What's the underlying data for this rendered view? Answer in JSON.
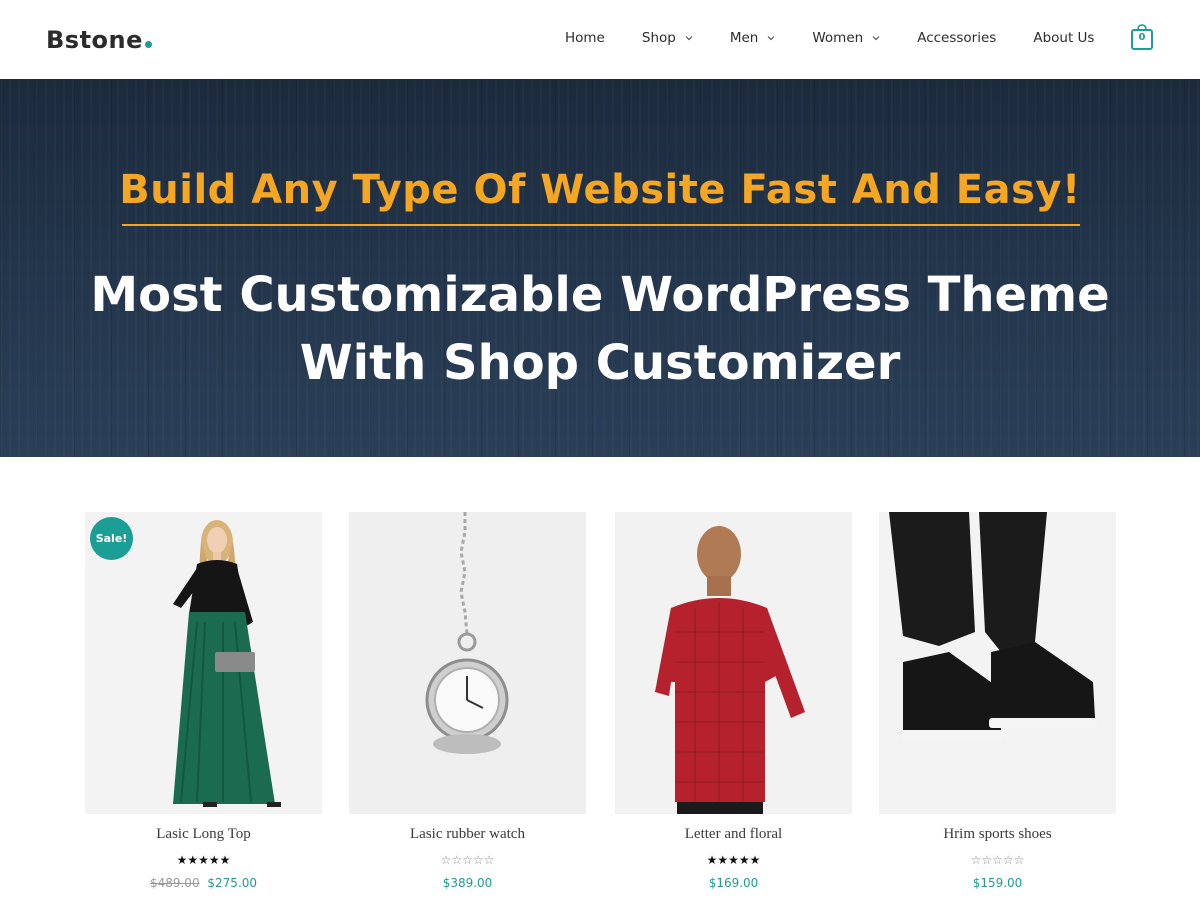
{
  "colors": {
    "accent": "#1a9e95",
    "tagline": "#f5a623",
    "hero_bg": "#22344a",
    "text": "#3a3a3a"
  },
  "header": {
    "logo_text": "Bstone",
    "nav": {
      "home": "Home",
      "shop": "Shop",
      "men": "Men",
      "women": "Women",
      "accessories": "Accessories",
      "about": "About Us"
    },
    "cart_count": "0",
    "cart_icon": "shopping-bag-icon"
  },
  "hero": {
    "tagline": "Build Any Type Of Website Fast And Easy!",
    "title_line1": "Most Customizable WordPress Theme",
    "title_line2": "With Shop Customizer"
  },
  "products": [
    {
      "name": "Lasic Long Top",
      "rating": 5,
      "old_price": "$489.00",
      "price": "$275.00",
      "badge": "Sale!"
    },
    {
      "name": "Lasic rubber watch",
      "rating": 0,
      "price": "$389.00"
    },
    {
      "name": "Letter and floral",
      "rating": 5,
      "price": "$169.00"
    },
    {
      "name": "Hrim sports shoes",
      "rating": 0,
      "price": "$159.00"
    }
  ]
}
